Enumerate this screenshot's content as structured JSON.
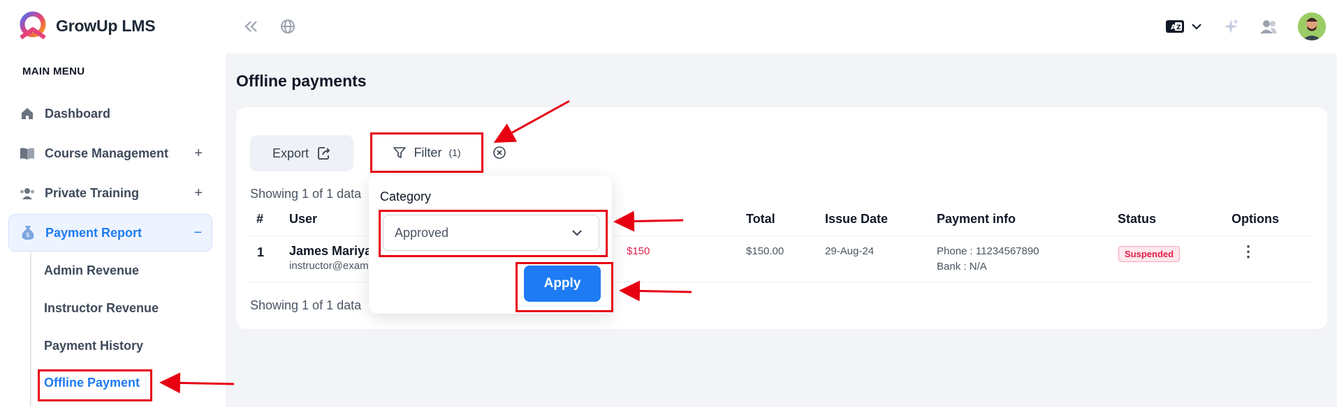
{
  "app": {
    "name": "GrowUp LMS"
  },
  "sidebar": {
    "menu_title": "MAIN MENU",
    "items": [
      {
        "label": "Dashboard",
        "icon": "home-icon",
        "toggle": ""
      },
      {
        "label": "Course Management",
        "icon": "book-icon",
        "toggle": "+"
      },
      {
        "label": "Private Training",
        "icon": "users-icon",
        "toggle": "+"
      },
      {
        "label": "Payment Report",
        "icon": "money-bag-icon",
        "toggle": "−"
      }
    ],
    "sub_items": [
      {
        "label": "Admin Revenue"
      },
      {
        "label": "Instructor Revenue"
      },
      {
        "label": "Payment History"
      },
      {
        "label": "Offline Payment"
      }
    ]
  },
  "topbar": {
    "icons": [
      "collapse-sidebar-icon",
      "globe-icon",
      "language-icon",
      "sparkle-icon",
      "users-icon",
      "avatar"
    ]
  },
  "main": {
    "title": "Offline payments",
    "toolbar": {
      "export_label": "Export",
      "filter_label": "Filter",
      "filter_count": "(1)"
    },
    "showing_top": "Showing 1 of 1 data",
    "showing_bottom": "Showing 1 of 1 data",
    "table": {
      "columns": [
        "#",
        "User",
        "Total",
        "Issue Date",
        "Payment info",
        "Status",
        "Options"
      ],
      "rows": [
        {
          "index": "1",
          "user_name": "James Mariya",
          "user_email": "instructor@exam",
          "amount": "$150",
          "total": "$150.00",
          "issue_date": "29-Aug-24",
          "phone": "Phone : 11234567890",
          "bank": "Bank : N/A",
          "status": "Suspended"
        }
      ]
    }
  },
  "filter_popover": {
    "category_label": "Category",
    "category_value": "Approved",
    "apply_label": "Apply"
  },
  "colors": {
    "accent": "#1e7bf3",
    "annotation": "#e60012",
    "status_suspended": "#e11d48"
  }
}
